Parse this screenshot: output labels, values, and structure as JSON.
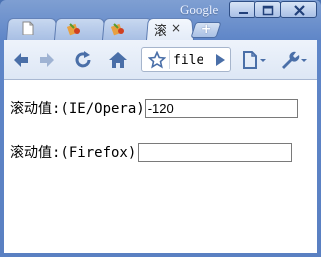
{
  "window": {
    "brand": "Google"
  },
  "tabs": [
    {
      "icon": "document-icon",
      "title": ""
    },
    {
      "icon": "favicon-icon",
      "title": ""
    },
    {
      "icon": "favicon-icon",
      "title": ""
    },
    {
      "icon": "",
      "title": "滚动",
      "close": "×"
    }
  ],
  "toolbar": {
    "url_value": "file"
  },
  "content": {
    "row1_label": "滚动值:(IE/Opera)",
    "row1_value": "-120",
    "row2_label": "滚动值:(Firefox)",
    "row2_value": ""
  }
}
